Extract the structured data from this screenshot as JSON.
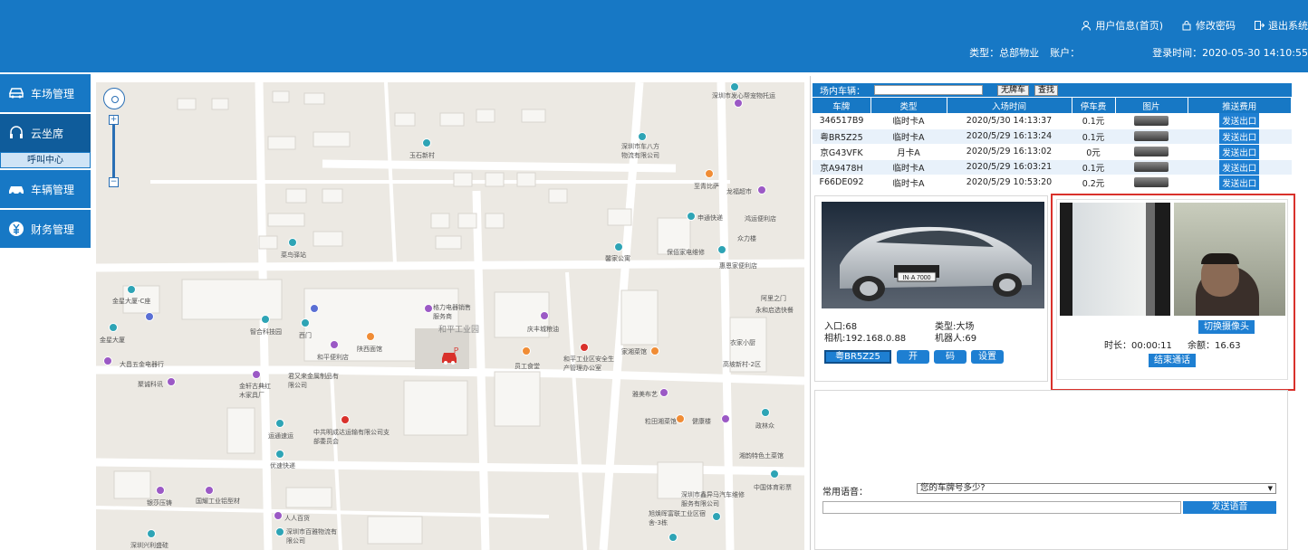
{
  "header": {
    "user_info": "用户信息(首页)",
    "change_password": "修改密码",
    "logout": "退出系统",
    "type_label": "类型：总部物业",
    "account_label": "账户：",
    "login_time": "登录时间：2020-05-30 14:10:55"
  },
  "sidebar": {
    "items": [
      {
        "label": "车场管理",
        "icon": "car-park-icon"
      },
      {
        "label": "云坐席",
        "icon": "headset-icon"
      },
      {
        "label": "车辆管理",
        "icon": "car-icon"
      },
      {
        "label": "财务管理",
        "icon": "yen-icon"
      }
    ],
    "sub_item": "呼叫中心"
  },
  "map": {
    "labels": [
      "玉石新村",
      "深圳市车八方物流有限公司",
      "深圳市发心帮宠物托运",
      "龙福超市",
      "申通快递",
      "保佰家电维修",
      "众力楼",
      "鸿运便利店",
      "惠恩家便利店",
      "金星大厦-C座",
      "金星大厦",
      "格力电器销售服务商",
      "和平工业园",
      "庆丰城粮油",
      "智合科技园",
      "西门",
      "陕西面馆",
      "和平便利店",
      "员工食堂",
      "和平工业区安全生产管理办公室",
      "家湘菜馆",
      "高坡新村-2区",
      "大昌五金电器行",
      "聚诚科讯",
      "金轩古典红木家具厂",
      "君又来金属制品有限公司",
      "雅美布艺",
      "粒田湘菜馆",
      "健康楼",
      "政林众",
      "衣家小厨",
      "永和启选快餐",
      "阿里之门",
      "中共明成达运输有限公司支部委员会",
      "运通速运",
      "优速快递",
      "湘韵特色土菜馆",
      "中国体育彩票",
      "深圳市鑫异马汽车维修服务有限公司",
      "旭焕晖富联工业区宿舍-3栋",
      "人人百货",
      "深圳市百雅物流有限公司",
      "国耀工业铝型材",
      "银莎压铸",
      "深圳兴利盛硅",
      "菜鸟驿站",
      "馨家公寓",
      "至青比萨"
    ]
  },
  "vehicle": {
    "bar_label": "场内车辆：",
    "search_value": "",
    "no_plate_btn": "无牌车",
    "query_btn": "查找",
    "columns": [
      "车牌",
      "类型",
      "入场时间",
      "停车费",
      "图片",
      "推送费用"
    ],
    "rows": [
      {
        "plate": "346517B9",
        "type": "临时卡A",
        "time": "2020/5/30 14:13:37",
        "fee": "0.1元",
        "action": "发送出口"
      },
      {
        "plate": "粤BR5Z25",
        "type": "临时卡A",
        "time": "2020/5/29 16:13:24",
        "fee": "0.1元",
        "action": "发送出口"
      },
      {
        "plate": "京G43VFK",
        "type": "月卡A",
        "time": "2020/5/29 16:13:02",
        "fee": "0元",
        "action": "发送出口"
      },
      {
        "plate": "京A9478H",
        "type": "临时卡A",
        "time": "2020/5/29 16:03:21",
        "fee": "0.1元",
        "action": "发送出口"
      },
      {
        "plate": "F66DE092",
        "type": "临时卡A",
        "time": "2020/5/29 10:53:20",
        "fee": "0.2元",
        "action": "发送出口"
      }
    ]
  },
  "gate": {
    "plate_on_car": "IN·A 7000",
    "entry": "入口:68",
    "type": "类型:大场",
    "camera": "相机:192.168.0.88",
    "robot": "机器人:69",
    "plate": "粤BR5Z25",
    "open_btn": "开",
    "code_btn": "码",
    "settings_btn": "设置"
  },
  "call": {
    "switch_camera": "切换摄像头",
    "duration": "时长：00:00:11",
    "balance": "余额：16.63",
    "end_call": "结束通话"
  },
  "voice": {
    "label": "常用语音：",
    "selected": "您的车牌号多少?",
    "send_btn": "发送语音",
    "input_value": ""
  },
  "colors": {
    "header": "#1778c5",
    "accent": "#1e7fd2",
    "highlight": "#d9312b"
  }
}
